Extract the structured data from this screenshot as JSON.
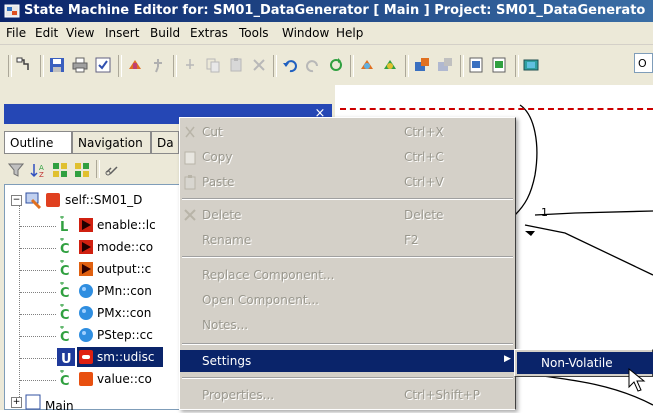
{
  "window": {
    "title": "State Machine Editor for: SM01_DataGenerator [ Main ] Project: SM01_DataGenerato"
  },
  "menubar": [
    "File",
    "Edit",
    "View",
    "Insert",
    "Build",
    "Extras",
    "Tools",
    "Window",
    "Help"
  ],
  "toolbar": {
    "icons": [
      "select-tool-icon",
      "save-icon",
      "print-icon",
      "checkmark-icon",
      "build-icon",
      "pin-icon",
      "cut-icon",
      "copy-icon",
      "paste-icon",
      "delete-icon",
      "undo-icon",
      "redo-icon",
      "refresh-icon",
      "transition-icon",
      "transition-alt-icon",
      "state-add-icon",
      "state-remove-icon",
      "zoom-in-icon",
      "zoom-out-icon",
      "view-icon"
    ],
    "combo_text": "O"
  },
  "panel": {
    "close_glyph": "×",
    "tabs": [
      "Outline",
      "Navigation",
      "Da"
    ]
  },
  "tree": {
    "root_label": "self::SM01_D",
    "items": [
      {
        "letter": "L",
        "label": "enable::lc",
        "bullet": "triangle-red"
      },
      {
        "letter": "C",
        "label": "mode::co",
        "bullet": "triangle-red"
      },
      {
        "letter": "C",
        "label": "output::c",
        "bullet": "triangle-orange"
      },
      {
        "letter": "C",
        "label": "PMn::con",
        "bullet": "circle-blue"
      },
      {
        "letter": "C",
        "label": "PMx::con",
        "bullet": "circle-blue"
      },
      {
        "letter": "C",
        "label": "PStep::cc",
        "bullet": "circle-blue"
      },
      {
        "letter": "U",
        "label": "sm::udisc",
        "bullet": "statemachine-red"
      },
      {
        "letter": "C",
        "label": "value::co",
        "bullet": "square-orange"
      }
    ],
    "partial_label": "Main"
  },
  "context_menu": {
    "items": [
      {
        "label": "Cut",
        "shortcut": "Ctrl+X",
        "enabled": false,
        "icon": "cut-icon"
      },
      {
        "label": "Copy",
        "shortcut": "Ctrl+C",
        "enabled": false,
        "icon": "copy-icon"
      },
      {
        "label": "Paste",
        "shortcut": "Ctrl+V",
        "enabled": false,
        "icon": "paste-icon"
      },
      {
        "label": "Delete",
        "shortcut": "Delete",
        "enabled": false,
        "icon": "delete-icon"
      },
      {
        "label": "Rename",
        "shortcut": "F2",
        "enabled": false
      },
      {
        "label": "Replace Component...",
        "shortcut": "",
        "enabled": false
      },
      {
        "label": "Open Component...",
        "shortcut": "",
        "enabled": false
      },
      {
        "label": "Notes...",
        "shortcut": "",
        "enabled": false
      },
      {
        "label": "Settings",
        "shortcut": "",
        "enabled": true,
        "highlighted": true,
        "submenu_arrow": "▶"
      },
      {
        "label": "Properties...",
        "shortcut": "Ctrl+Shift+P",
        "enabled": false
      }
    ]
  },
  "submenu": {
    "items": [
      {
        "label": "Non-Volatile",
        "highlighted": true
      }
    ]
  },
  "canvas": {
    "transition_label": "1"
  },
  "colors": {
    "titlebar": "#0a246a",
    "highlight": "#0a246a",
    "panel_header": "#2547b5",
    "selection_dash": "#cc0000"
  }
}
